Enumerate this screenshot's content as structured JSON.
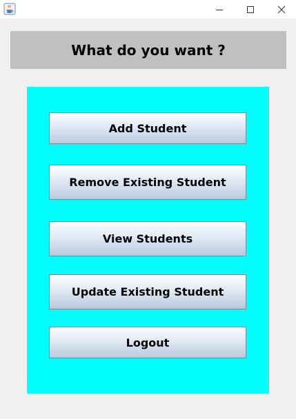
{
  "window": {
    "app_icon": "java-coffee-cup-icon",
    "controls": {
      "minimize": "minimize-icon",
      "maximize": "maximize-icon",
      "close": "close-icon"
    }
  },
  "header": {
    "title": "What do you want ?"
  },
  "menu": {
    "panel_color": "#00ffff",
    "buttons": [
      {
        "label": "Add Student"
      },
      {
        "label": "Remove Existing Student"
      },
      {
        "label": "View Students"
      },
      {
        "label": "Update Existing Student"
      },
      {
        "label": "Logout"
      }
    ]
  }
}
